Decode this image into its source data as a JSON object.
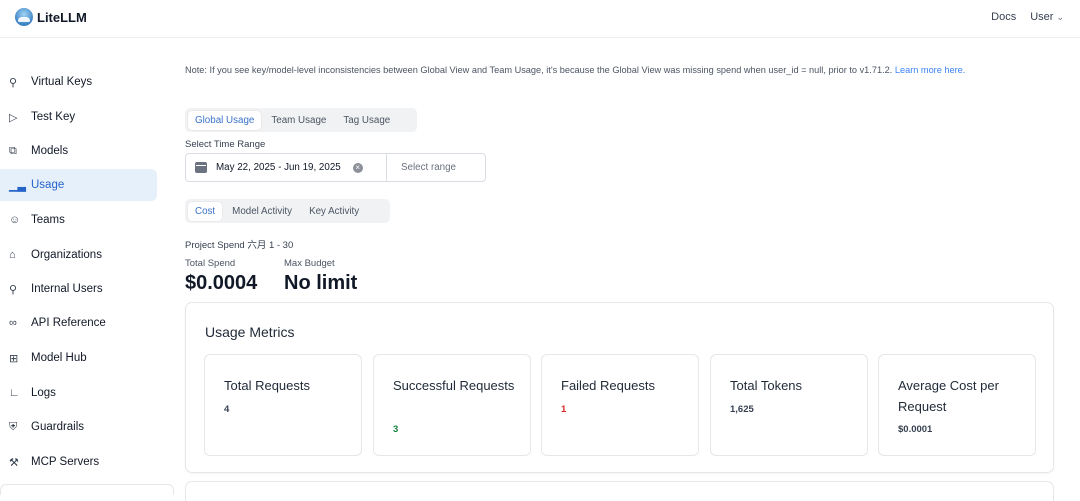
{
  "header": {
    "brand": "LiteLLM",
    "docs_label": "Docs",
    "user_label": "User"
  },
  "sidebar": {
    "items": [
      {
        "label": "Virtual Keys",
        "icon": "key-icon"
      },
      {
        "label": "Test Key",
        "icon": "play-circle-icon"
      },
      {
        "label": "Models",
        "icon": "block-icon"
      },
      {
        "label": "Usage",
        "icon": "bar-chart-icon",
        "active": true
      },
      {
        "label": "Teams",
        "icon": "team-icon"
      },
      {
        "label": "Organizations",
        "icon": "bank-icon"
      },
      {
        "label": "Internal Users",
        "icon": "user-icon"
      },
      {
        "label": "API Reference",
        "icon": "api-icon"
      },
      {
        "label": "Model Hub",
        "icon": "grid-icon"
      },
      {
        "label": "Logs",
        "icon": "line-chart-icon"
      },
      {
        "label": "Guardrails",
        "icon": "shield-icon"
      },
      {
        "label": "MCP Servers",
        "icon": "tool-icon"
      }
    ]
  },
  "main": {
    "note_text": "Note: If you see key/model-level inconsistencies between Global View and Team Usage, it's because the Global View was missing spend when user_id = null, prior to v1.71.2.",
    "note_link": "Learn more here.",
    "view_tabs": [
      "Global Usage",
      "Team Usage",
      "Tag Usage"
    ],
    "time_range_label": "Select Time Range",
    "date_range": "May 22, 2025 - Jun 19, 2025",
    "select_range_label": "Select range",
    "metric_tabs": [
      "Cost",
      "Model Activity",
      "Key Activity"
    ],
    "project_spend": "Project Spend 六月 1 - 30",
    "total_spend_label": "Total Spend",
    "total_spend_value": "$0.0004",
    "max_budget_label": "Max Budget",
    "max_budget_value": "No limit",
    "usage_metrics": {
      "title": "Usage Metrics",
      "cards": [
        {
          "title": "Total Requests",
          "value": "4"
        },
        {
          "title": "Successful Requests",
          "value": "3",
          "color": "#15803d"
        },
        {
          "title": "Failed Requests",
          "value": "1",
          "color": "#dc2626"
        },
        {
          "title": "Total Tokens",
          "value": "1,625"
        },
        {
          "title": "Average Cost per Request",
          "value": "$0.0001"
        }
      ]
    }
  },
  "colors": {
    "accent": "#2563c9",
    "active_bg": "#e6f0fb",
    "success": "#15803d",
    "danger": "#dc2626",
    "link": "#3b82f6"
  }
}
